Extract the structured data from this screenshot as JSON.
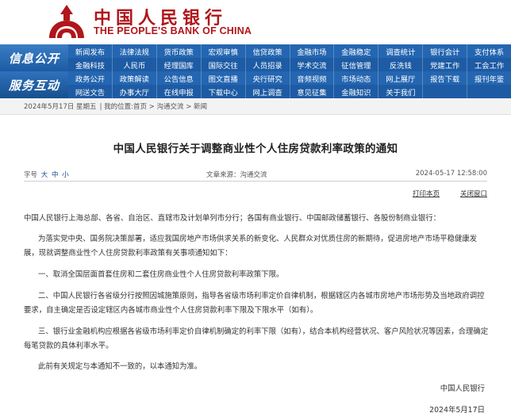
{
  "header": {
    "logo_cn": "中国人民银行",
    "logo_en": "THE PEOPLE'S BANK OF CHINA",
    "brand_color": "#b0161b"
  },
  "nav": {
    "band_1": "信息公开",
    "band_2": "服务互动",
    "rows": [
      [
        "新闻发布",
        "法律法规",
        "货币政策",
        "宏观审慎",
        "信贷政策",
        "金融市场",
        "金融稳定",
        "调查统计",
        "银行会计",
        "支付体系"
      ],
      [
        "金融科技",
        "人民币",
        "经理国库",
        "国际交往",
        "人员招录",
        "学术交流",
        "征信管理",
        "反洗钱",
        "党建工作",
        "工会工作"
      ],
      [
        "政务公开",
        "政策解读",
        "公告信息",
        "图文直播",
        "央行研究",
        "音频视频",
        "市场动态",
        "网上展厅",
        "报告下载",
        "报刊年鉴"
      ],
      [
        "网送文告",
        "办事大厅",
        "在线申报",
        "下载中心",
        "网上调查",
        "意见征集",
        "金融知识",
        "关于我们",
        "",
        ""
      ]
    ],
    "color": "#1e5da6"
  },
  "breadcrumb": {
    "date": "2024年5月17日 星期五",
    "location": "| 我的位置:首页 > 沟通交流 > 新闻"
  },
  "article": {
    "title": "中国人民银行关于调整商业性个人住房贷款利率政策的通知",
    "font_label": "字号",
    "font_sizes": [
      "大",
      "中",
      "小"
    ],
    "source": "文章来源：沟通交流",
    "datetime": "2024-05-17 12:58:00",
    "print_label": "打印本页",
    "close_label": "关闭窗口",
    "paragraphs": [
      "中国人民银行上海总部、各省、自治区、直辖市及计划单列市分行；各国有商业银行、中国邮政储蓄银行、各股份制商业银行：",
      "为落实党中央、国务院决策部署，适应我国房地产市场供求关系的新变化、人民群众对优质住房的新期待，促进房地产市场平稳健康发展，现就调整商业性个人住房贷款利率政策有关事项通知如下：",
      "一、取消全国层面首套住房和二套住房商业性个人住房贷款利率政策下限。",
      "二、中国人民银行各省级分行按照因城施策原则，指导各省级市场利率定价自律机制，根据辖区内各城市房地产市场形势及当地政府调控要求，自主确定是否设定辖区内各城市商业性个人住房贷款利率下限及下限水平（如有）。",
      "三、银行业金融机构应根据各省级市场利率定价自律机制确定的利率下限（如有），结合本机构经营状况、客户风险状况等因素，合理确定每笔贷款的具体利率水平。",
      "此前有关规定与本通知不一致的，以本通知为准。"
    ],
    "signature": "中国人民银行",
    "sign_date": "2024年5月17日"
  }
}
